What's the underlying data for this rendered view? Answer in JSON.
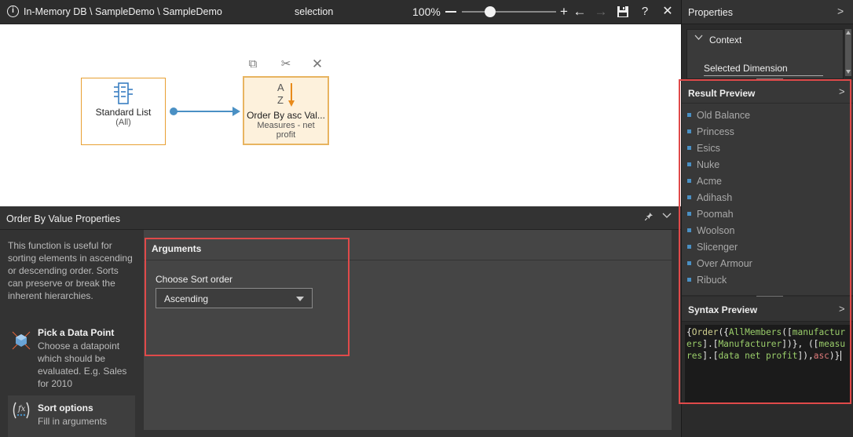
{
  "topbar": {
    "info_icon": "i",
    "path": "In-Memory DB \\ SampleDemo \\ SampleDemo",
    "mode": "selection",
    "zoom": "100%",
    "zoom_out": "−",
    "zoom_in": "+",
    "undo": "←",
    "redo": "→",
    "save": "💾",
    "help": "?",
    "close": "✕"
  },
  "canvas": {
    "node_list": {
      "title": "Standard List",
      "sub": "(All)"
    },
    "node_order": {
      "title": "Order By asc Val...",
      "sub": "Measures - net profit",
      "glyph_a": "A",
      "glyph_z": "Z"
    },
    "tools": {
      "copy": "⧉",
      "cut": "✂",
      "delete": "✕"
    }
  },
  "props": {
    "title": "Order By Value Properties",
    "pin": "📌",
    "collapse": "⌵",
    "description": "This function is useful for sorting elements in ascending or descending order. Sorts can preserve or break the inherent hierarchies.",
    "steps": [
      {
        "name": "Pick a Data Point",
        "hint": "Choose a datapoint which should be evaluated. E.g. Sales for 2010"
      },
      {
        "name": "Sort options",
        "hint": "Fill in arguments"
      }
    ],
    "arguments": {
      "title": "Arguments",
      "sort_label": "Choose Sort order",
      "sort_value": "Ascending"
    }
  },
  "right": {
    "title": "Properties",
    "context": {
      "title": "Context",
      "selected": "Selected Dimension"
    },
    "result_preview": {
      "title": "Result Preview",
      "items": [
        "Old Balance",
        "Princess",
        "Esics",
        "Nuke",
        "Acme",
        "Adihash",
        "Poomah",
        "Woolson",
        "Slicenger",
        "Over Armour",
        "Ribuck"
      ]
    },
    "syntax_preview": {
      "title": "Syntax Preview",
      "tokens": [
        {
          "t": "{",
          "c": ""
        },
        {
          "t": "Order",
          "c": "c-fn"
        },
        {
          "t": "({",
          "c": ""
        },
        {
          "t": "AllMembers",
          "c": "c-id"
        },
        {
          "t": "([",
          "c": ""
        },
        {
          "t": "manufacturers",
          "c": "c-id"
        },
        {
          "t": "].[",
          "c": ""
        },
        {
          "t": "Manufacturer",
          "c": "c-id"
        },
        {
          "t": "])}, ([",
          "c": ""
        },
        {
          "t": "measures",
          "c": "c-id"
        },
        {
          "t": "].[",
          "c": ""
        },
        {
          "t": "data net profit",
          "c": "c-id"
        },
        {
          "t": "]),",
          "c": ""
        },
        {
          "t": "asc",
          "c": "c-kw"
        },
        {
          "t": ")}",
          "c": ""
        }
      ]
    },
    "chevron": ">"
  }
}
